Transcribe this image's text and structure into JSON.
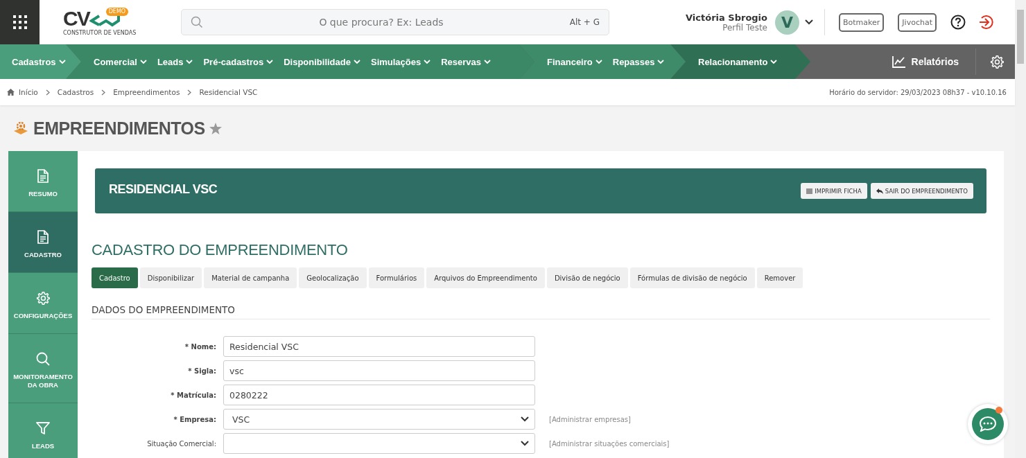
{
  "header": {
    "logo": {
      "text": "CV",
      "badge": "DEMO",
      "tagline": "CONSTRUTOR DE VENDAS"
    },
    "search": {
      "placeholder": "O que procura? Ex: Leads",
      "shortcut": "Alt + G"
    },
    "user": {
      "name": "Victória Sbrogio",
      "profile": "Perfil Teste",
      "initial": "V"
    },
    "buttons": [
      "Botmaker",
      "Jivochat"
    ]
  },
  "nav": {
    "groups": [
      {
        "color": "#4a9e7b",
        "items": [
          "Cadastros"
        ]
      },
      {
        "color": "#3a8866",
        "items": [
          "Comercial",
          "Leads",
          "Pré-cadastros",
          "Disponibilidade",
          "Simulações",
          "Reservas"
        ]
      },
      {
        "color": "#3d8b69",
        "items": [
          "Financeiro",
          "Repasses"
        ]
      },
      {
        "color": "#2f7055",
        "items": [
          "Relacionamento"
        ]
      }
    ],
    "reports": "Relatórios"
  },
  "breadcrumb": [
    "Início",
    "Cadastros",
    "Empreendimentos",
    "Residencial VSC"
  ],
  "server_time": "Horário do servidor: 29/03/2023 08h37 - v10.10.16",
  "page_title": "EMPREENDIMENTOS",
  "sidebar": {
    "items": [
      {
        "label": "RESUMO",
        "kind": "doc",
        "selected": false
      },
      {
        "label": "CADASTRO",
        "kind": "doc",
        "selected": true
      },
      {
        "label": "CONFIGURAÇÕES",
        "kind": "gear",
        "selected": false
      },
      {
        "label": "MONITORAMENTO DA OBRA",
        "kind": "search",
        "selected": false
      },
      {
        "label": "LEADS",
        "kind": "filter",
        "selected": false
      }
    ]
  },
  "banner": {
    "title": "RESIDENCIAL VSC",
    "buttons": [
      {
        "label": "IMPRIMIR FICHA",
        "kind": "print"
      },
      {
        "label": "SAIR DO EMPREENDIMENTO",
        "kind": "back"
      }
    ]
  },
  "section_title": "CADASTRO DO EMPREENDIMENTO",
  "tabs": [
    {
      "label": "Cadastro",
      "selected": true
    },
    {
      "label": "Disponibilizar",
      "selected": false
    },
    {
      "label": "Material de campanha",
      "selected": false
    },
    {
      "label": "Geolocalização",
      "selected": false
    },
    {
      "label": "Formulários",
      "selected": false
    },
    {
      "label": "Arquivos do Empreendimento",
      "selected": false
    },
    {
      "label": "Divisão de negócio",
      "selected": false
    },
    {
      "label": "Fórmulas de divisão de negócio",
      "selected": false
    },
    {
      "label": "Remover",
      "selected": false
    }
  ],
  "form": {
    "title": "DADOS DO EMPREENDIMENTO",
    "fields": [
      {
        "label": "* Nome:",
        "kind": "input",
        "value": "Residencial VSC",
        "required": true
      },
      {
        "label": "* Sigla:",
        "kind": "input",
        "value": "vsc",
        "required": true
      },
      {
        "label": "* Matrícula:",
        "kind": "input",
        "value": "0280222",
        "required": true
      },
      {
        "label": "* Empresa:",
        "kind": "select",
        "value": "VSC",
        "link": "[Administrar empresas]",
        "required": true
      },
      {
        "label": "Situação Comercial:",
        "kind": "select",
        "link": "[Administrar situações comerciais]",
        "required": false
      }
    ]
  },
  "chat": {
    "notification": true
  }
}
